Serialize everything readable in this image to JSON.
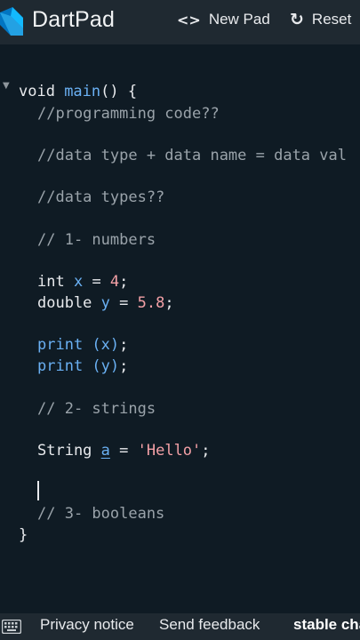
{
  "header": {
    "title": "DartPad",
    "new_pad_label": "New Pad",
    "new_pad_icon": "<>",
    "reset_label": "Reset",
    "reset_icon": "↻"
  },
  "editor": {
    "lines": [
      "void main() {",
      "//programming code??",
      "//data type + data name = data val",
      "//data types??",
      "// 1- numbers",
      "int x = 4;",
      "double y = 5.8;",
      "print (x);",
      "print (y);",
      "// 2- strings",
      "String a = 'Hello';",
      "// 3- booleans",
      "}"
    ]
  },
  "footer": {
    "privacy_label": "Privacy notice",
    "feedback_label": "Send feedback",
    "channel_label": "stable cha"
  },
  "colors": {
    "background": "#0f1b24",
    "bar": "#1f2931",
    "identifier": "#6ab0f3",
    "literal": "#f3a0a6",
    "comment": "#9aa3aa",
    "logo_dark": "#0175c2",
    "logo_light": "#13b9fd"
  }
}
